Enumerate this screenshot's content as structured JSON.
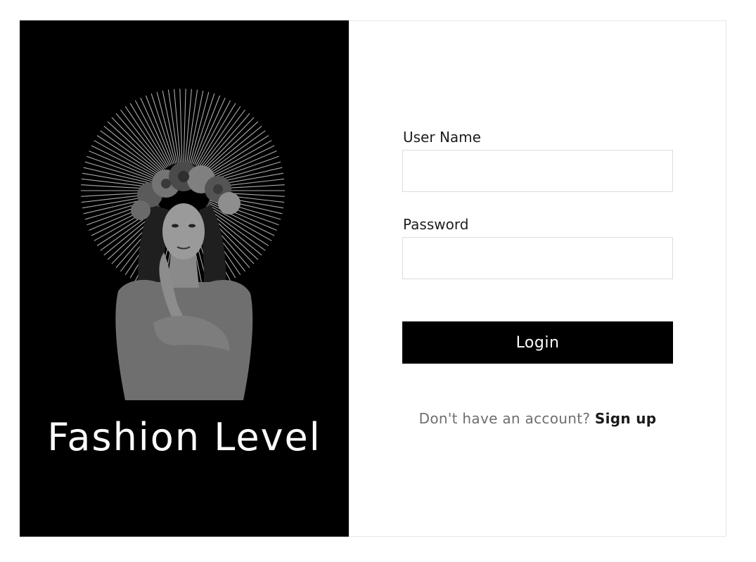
{
  "brand": {
    "title": "Fashion Level"
  },
  "login_form": {
    "username_label": "User Name",
    "username_value": "",
    "password_label": "Password",
    "password_value": "",
    "login_label": "Login",
    "signup_prompt": "Don't have an account?",
    "signup_link": "Sign up"
  },
  "colors": {
    "panel_background": "#000000",
    "button_background": "#000000",
    "button_text": "#ffffff",
    "muted_text": "#6e6e6e"
  }
}
